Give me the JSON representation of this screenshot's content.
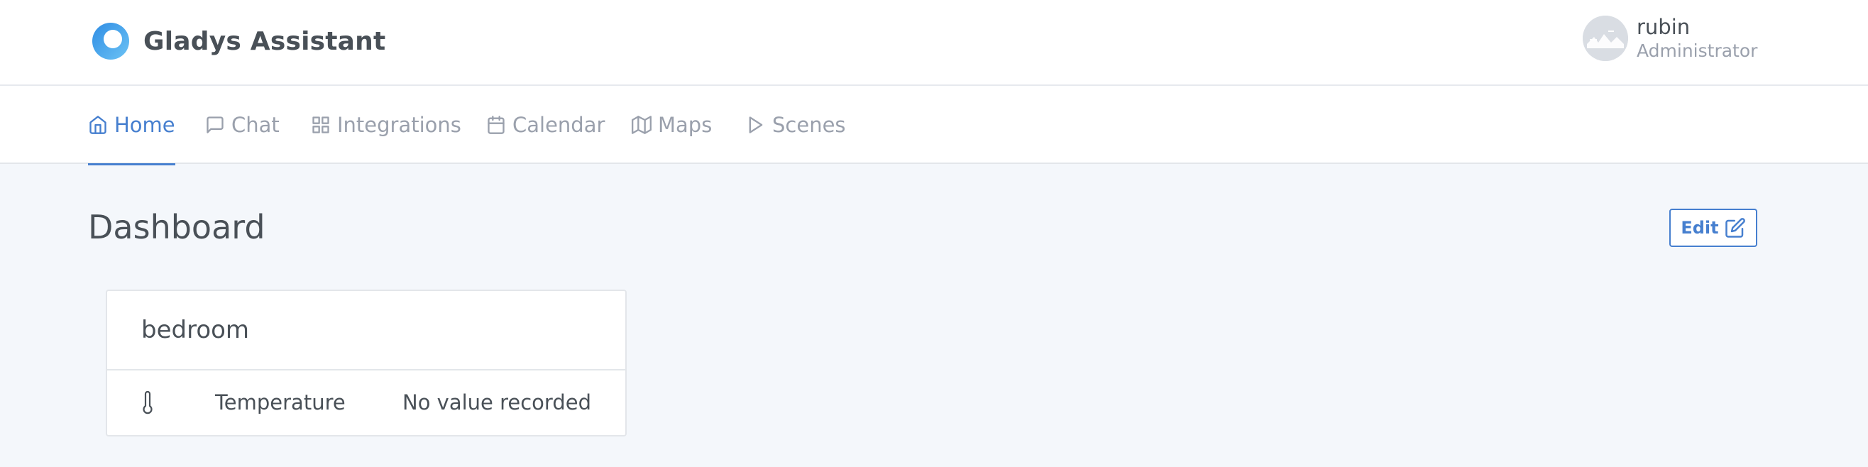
{
  "header": {
    "brand_name": "Gladys Assistant",
    "user": {
      "name": "rubin",
      "role": "Administrator"
    }
  },
  "nav": {
    "items": [
      {
        "label": "Home",
        "icon": "home-icon",
        "active": true
      },
      {
        "label": "Chat",
        "icon": "message-square-icon",
        "active": false
      },
      {
        "label": "Integrations",
        "icon": "grid-icon",
        "active": false
      },
      {
        "label": "Calendar",
        "icon": "calendar-icon",
        "active": false
      },
      {
        "label": "Maps",
        "icon": "map-icon",
        "active": false
      },
      {
        "label": "Scenes",
        "icon": "play-icon",
        "active": false
      }
    ]
  },
  "main": {
    "title": "Dashboard",
    "edit_label": "Edit",
    "boxes": [
      {
        "title": "bedroom",
        "rows": [
          {
            "icon": "thermometer-icon",
            "label": "Temperature",
            "value": "No value recorded"
          }
        ]
      }
    ]
  },
  "colors": {
    "accent": "#467fcf",
    "background": "#f4f7fb",
    "muted_text": "#9aa0ac",
    "text": "#495057"
  }
}
